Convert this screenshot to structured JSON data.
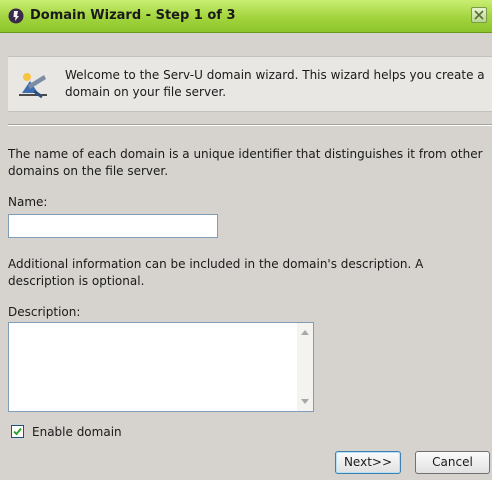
{
  "window": {
    "title": "Domain Wizard - Step 1 of 3"
  },
  "banner": {
    "text": "Welcome to the Serv-U domain wizard. This wizard helps you create a domain on your file server.",
    "icon": "wizard-icon"
  },
  "intro_text": "The name of each domain is a unique identifier that distinguishes it from other domains on the file server.",
  "name_field": {
    "label": "Name:",
    "value": ""
  },
  "description_info": "Additional information can be included in the domain's description. A description is optional.",
  "description_field": {
    "label": "Description:",
    "value": ""
  },
  "enable_domain": {
    "label": "Enable domain",
    "checked": true
  },
  "buttons": {
    "next": "Next>>",
    "cancel": "Cancel"
  },
  "colors": {
    "titlebar": "#a2d43e",
    "background": "#d6d3ce"
  }
}
